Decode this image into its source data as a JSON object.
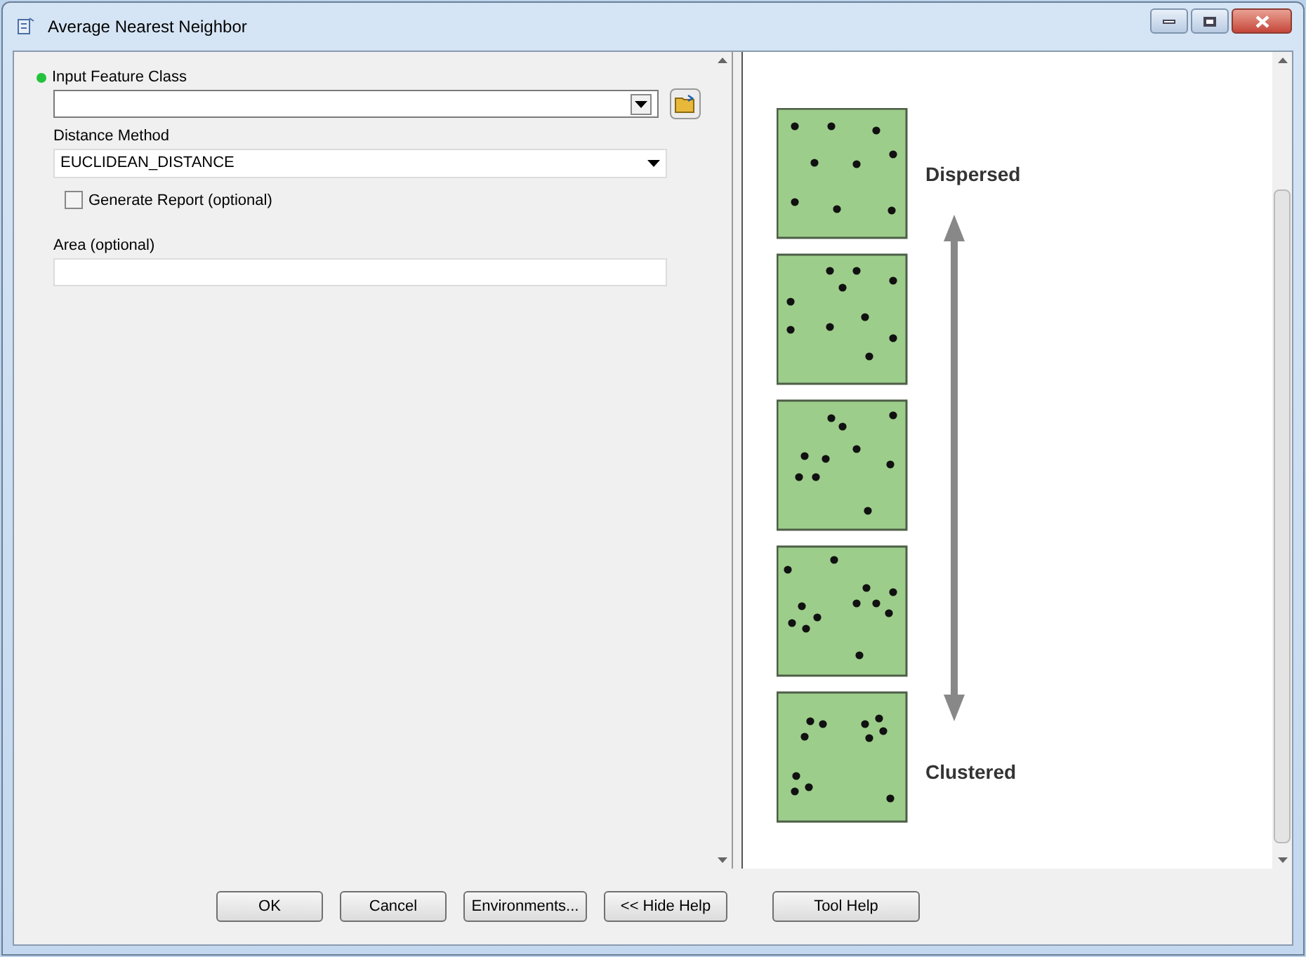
{
  "window": {
    "title": "Average Nearest Neighbor"
  },
  "parameters": [
    {
      "kind": "combo",
      "label": "Input Feature Class",
      "required": true
    },
    {
      "kind": "dropdown",
      "label": "Distance Method",
      "value": "EUCLIDEAN_DISTANCE"
    },
    {
      "kind": "checkbox",
      "label": "Generate Report (optional)",
      "checked": false
    },
    {
      "kind": "text",
      "label": "Area (optional)"
    }
  ],
  "help_panel": {
    "top_label": "Dispersed",
    "bottom_label": "Clustered"
  },
  "buttons": [
    "OK",
    "Cancel",
    "Environments...",
    "<< Hide Help",
    "Tool Help"
  ]
}
